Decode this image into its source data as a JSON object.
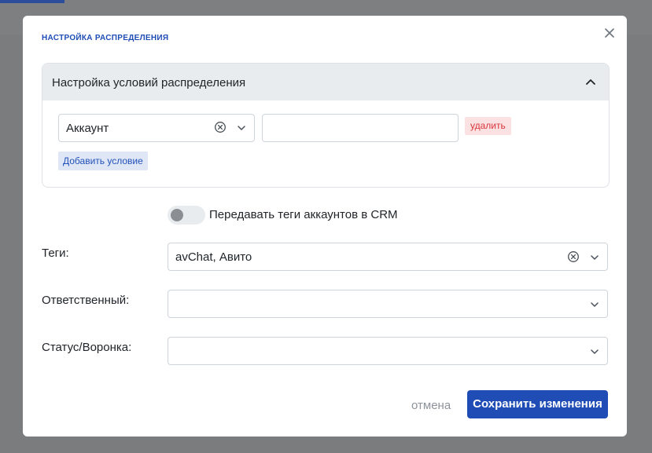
{
  "modal": {
    "title": "НАСТРОЙКА РАСПРЕДЕЛЕНИЯ",
    "close_icon": "close-icon"
  },
  "conditions": {
    "title": "Настройка условий распределения",
    "expanded": true,
    "rows": [
      {
        "field": "Аккаунт",
        "value": "",
        "delete_label": "удалить"
      }
    ],
    "add_label": "Добавить условие"
  },
  "toggle": {
    "label": "Передавать теги аккаунтов в CRM",
    "checked": false
  },
  "fields": {
    "tags": {
      "label": "Теги:",
      "value": "avChat, Авито"
    },
    "responsible": {
      "label": "Ответственный:",
      "value": ""
    },
    "status": {
      "label": "Статус/Воронка:",
      "value": ""
    }
  },
  "footer": {
    "cancel_label": "отмена",
    "save_label": "Сохранить изменения"
  },
  "colors": {
    "primary": "#1f4db5",
    "danger": "#d9363e",
    "danger_bg": "#fbe1e1",
    "accordion_header": "#e9ecef",
    "overlay": "#7b7c7e"
  }
}
